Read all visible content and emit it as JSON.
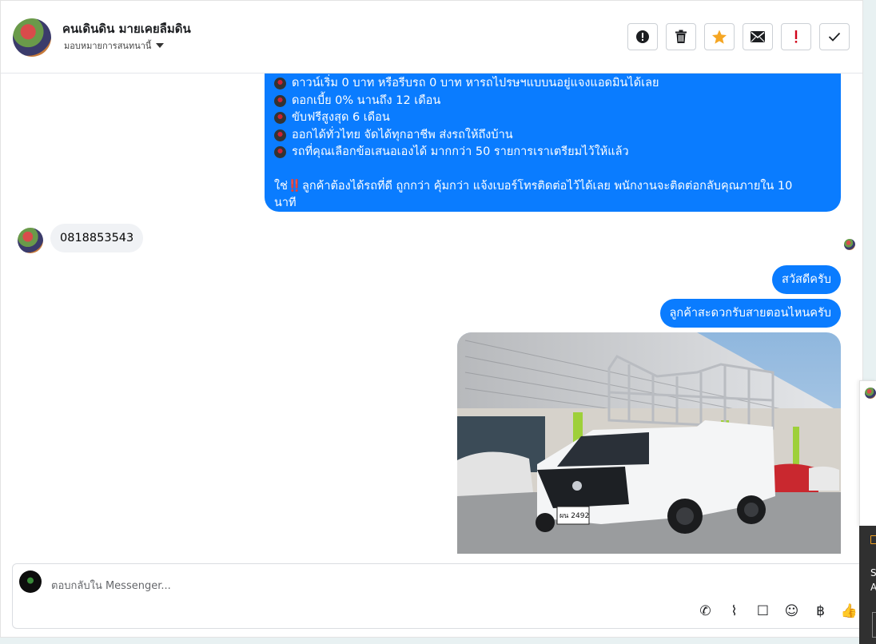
{
  "header": {
    "name": "คนเดินดิน มายเคยลืมดิน",
    "subtitle": "มอบหมายการสนทนานี้",
    "actions": [
      {
        "icon": "alert-circle-icon"
      },
      {
        "icon": "trash-icon"
      },
      {
        "icon": "star-icon",
        "color": "#f5a623"
      },
      {
        "icon": "envelope-icon"
      },
      {
        "icon": "exclamation-icon",
        "color": "#d0021b"
      },
      {
        "icon": "check-icon"
      }
    ]
  },
  "thread": {
    "promo_lines": [
      "ดาวน์เริ่ม 0 บาท หรือรีบรถ 0 บาท หารถไปรษฯแบบนอยู่แจงแอดมินได้เลย",
      "ดอกเบี้ย 0% นานถึง 12 เดือน",
      "ขับฟรีสูงสุด 6 เดือน",
      "ออกได้ทั่วไทย จัดได้ทุกอาชีพ ส่งรถให้ถึงบ้าน",
      "รถที่คุณเลือกข้อเสนอเองได้ มากกว่า 50 รายการเราเตรียมไว้ให้แล้ว"
    ],
    "promo_footer_pre": "ใช่",
    "promo_footer_mark": "‼️",
    "promo_footer_line1": "ลูกค้าต้องได้รถที่ดี ถูกกว่า คุ้มกว่า แจ้งเบอร์โทรติดต่อไว้ได้เลย พนักงานจะติดต่อกลับคุณภายใน 10",
    "promo_footer_line2": "นาที",
    "customer_phone": "0818853543",
    "reply_1": "สวัสดีครับ",
    "reply_2": "ลูกค้าสะดวกรับสายตอนไหนครับ",
    "photo_plate": "ผน 2492"
  },
  "composer": {
    "placeholder": "ตอบกลับใน Messenger...",
    "tools": [
      "phone-add-icon",
      "paperclip-icon",
      "saved-reply-icon",
      "emoji-icon",
      "baht-icon",
      "thumbs-up-icon"
    ],
    "tool_glyphs": [
      "✆",
      "⌇",
      "☐",
      "☺",
      "฿",
      "👍"
    ]
  },
  "side_panel": {
    "letters": [
      "S",
      "A"
    ]
  },
  "colors": {
    "outgoing_bubble": "#0a7cff",
    "incoming_bubble": "#f0f2f5",
    "star": "#f5a623"
  }
}
